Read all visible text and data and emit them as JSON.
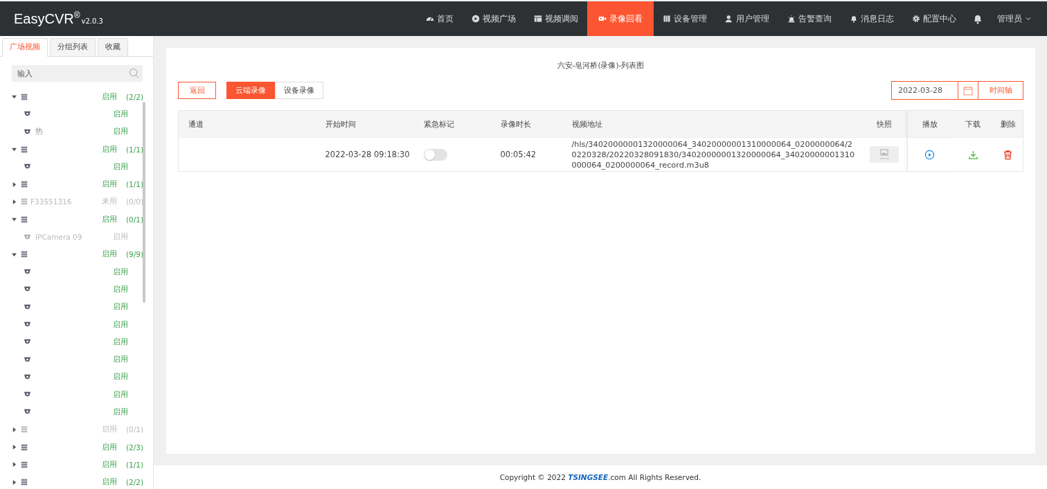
{
  "brand": {
    "name": "EasyCVR",
    "mark": "®",
    "version": "v2.0.3"
  },
  "nav": [
    {
      "label": "首页",
      "selected": false
    },
    {
      "label": "视频广场",
      "selected": false
    },
    {
      "label": "视频调阅",
      "selected": false
    },
    {
      "label": "录像回看",
      "selected": true
    },
    {
      "label": "设备管理",
      "selected": false
    },
    {
      "label": "用户管理",
      "selected": false
    },
    {
      "label": "告警查询",
      "selected": false
    },
    {
      "label": "消息日志",
      "selected": false
    },
    {
      "label": "配置中心",
      "selected": false
    }
  ],
  "user": {
    "name": "管理员"
  },
  "sidebar": {
    "tabs": [
      {
        "label": "广场视频",
        "selected": true
      },
      {
        "label": "分组列表",
        "selected": false
      },
      {
        "label": "收藏",
        "selected": false
      }
    ],
    "search": {
      "placeholder": "输入"
    },
    "tree": [
      {
        "status": "启用",
        "count": "(2/2)",
        "expanded": true,
        "disabled": false,
        "children": [
          {
            "status": "启用",
            "disabled": false
          },
          {
            "name": "热",
            "status": "启用",
            "disabled": false
          }
        ]
      },
      {
        "status": "启用",
        "count": "(1/1)",
        "expanded": true,
        "disabled": false,
        "children": [
          {
            "status": "启用",
            "disabled": false
          }
        ]
      },
      {
        "status": "启用",
        "count": "(1/1)",
        "expanded": false,
        "disabled": false
      },
      {
        "name": "F33551316",
        "status": "未用",
        "count": "(0/0)",
        "expanded": false,
        "disabled": true
      },
      {
        "status": "启用",
        "count": "(0/1)",
        "expanded": true,
        "disabled": false,
        "children": [
          {
            "name": "IPCamera 09",
            "status": "启用",
            "disabled": true
          }
        ]
      },
      {
        "status": "启用",
        "count": "(9/9)",
        "expanded": true,
        "disabled": false,
        "children": [
          {
            "status": "启用",
            "disabled": false
          },
          {
            "status": "启用",
            "disabled": false
          },
          {
            "status": "启用",
            "disabled": false
          },
          {
            "status": "启用",
            "disabled": false
          },
          {
            "status": "启用",
            "disabled": false
          },
          {
            "status": "启用",
            "disabled": false
          },
          {
            "status": "启用",
            "disabled": false
          },
          {
            "status": "启用",
            "disabled": false
          },
          {
            "status": "启用",
            "disabled": false
          }
        ]
      },
      {
        "status": "启用",
        "count": "(0/1)",
        "expanded": false,
        "disabled": true
      },
      {
        "status": "启用",
        "count": "(2/3)",
        "expanded": false,
        "disabled": false
      },
      {
        "status": "启用",
        "count": "(1/1)",
        "expanded": false,
        "disabled": false
      },
      {
        "status": "启用",
        "count": "(2/2)",
        "expanded": false,
        "disabled": false
      }
    ]
  },
  "panel": {
    "title": "六安-皂河桥(录像)-列表图",
    "back": "返回",
    "source_tabs": [
      {
        "label": "云端录像",
        "selected": true
      },
      {
        "label": "设备录像",
        "selected": false
      }
    ],
    "date": "2022-03-28",
    "timeline": "时间轴",
    "table": {
      "columns": [
        "通道",
        "开始时间",
        "紧急标记",
        "录像时长",
        "视频地址",
        "快照",
        "播放",
        "下载",
        "删除"
      ],
      "rows": [
        {
          "start": "2022-03-28 09:18:30",
          "urgent": false,
          "duration": "00:05:42",
          "url": "/hls/34020000001320000064_34020000001310000064_0200000064/20220328/20220328091830/34020000001320000064_34020000001310000064_0200000064_record.m3u8"
        }
      ]
    }
  },
  "footer": {
    "before": "Copyright © 2022 ",
    "logo": "TSINGSEE",
    "after": ".com All Rights Reserved."
  }
}
